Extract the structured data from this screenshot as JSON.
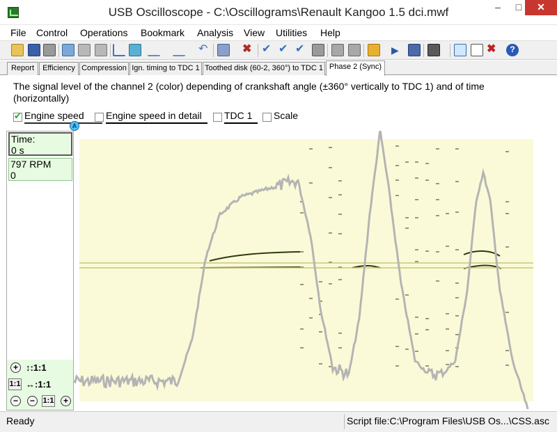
{
  "window": {
    "title": "USB Oscilloscope - C:\\Oscillograms\\Renault Kangoo 1.5 dci.mwf",
    "minimize_glyph": "–",
    "maximize_glyph": "□",
    "close_glyph": "✕"
  },
  "menu": {
    "items": [
      "File",
      "Control",
      "Operations",
      "Bookmark",
      "Analysis",
      "View",
      "Utilities",
      "Help"
    ]
  },
  "tabs": [
    {
      "label": "Report"
    },
    {
      "label": "Efficiency"
    },
    {
      "label": "Compression"
    },
    {
      "label": "Ign. timing to TDC 1"
    },
    {
      "label": "Toothed disk (60-2, 360°) to TDC 1"
    },
    {
      "label": "Phase 2 (Sync)",
      "active": true
    }
  ],
  "description": "The signal level of the channel 2 (color) depending of crankshaft angle (±360° vertically to TDC 1) and of time (horizontally)",
  "options": {
    "engine_speed": {
      "label": "Engine speed",
      "checked": true
    },
    "engine_speed_detail": {
      "label": "Engine speed in detail",
      "checked": false
    },
    "tdc1": {
      "label": "TDC 1",
      "checked": false
    },
    "scale": {
      "label": "Scale",
      "checked": false
    },
    "marker_label": "A"
  },
  "readout": {
    "time_label": "Time:",
    "time_value": "0 s",
    "rpm_value": "797 RPM",
    "rpm_sub": "0"
  },
  "scale_controls": {
    "vertical_scale": "↕:1:1",
    "horizontal_scale": "↔:1:1",
    "zoom_in": "+",
    "zoom_out": "−",
    "one_to_one": "1:1"
  },
  "status": {
    "left": "Ready",
    "right": "Script file:C:\\Program Files\\USB Os...\\CSS.asc"
  },
  "colors": {
    "plot_bg": "#fafad8",
    "waveform": "#b4b4b4",
    "trace_dark": "#2f3a0c",
    "trace_yellow": "#c8c87a",
    "panel_green": "#e7fbe2"
  },
  "icons": [
    "open-icon",
    "save-icon",
    "print-icon",
    "export-icon",
    "copy-icon",
    "paste-icon",
    "cursor-icon",
    "measure-icon",
    "filter-icon",
    "wave-icon",
    "undo-icon",
    "screen-icon",
    "delete-icon",
    "check-icon",
    "check-down-icon",
    "check-all-icon",
    "page-icon",
    "grid-icon",
    "tool-icon",
    "folder-icon",
    "play-icon",
    "stop-icon",
    "keyboard-icon",
    "chart-icon",
    "doc-icon",
    "close-red-icon",
    "help-icon"
  ]
}
